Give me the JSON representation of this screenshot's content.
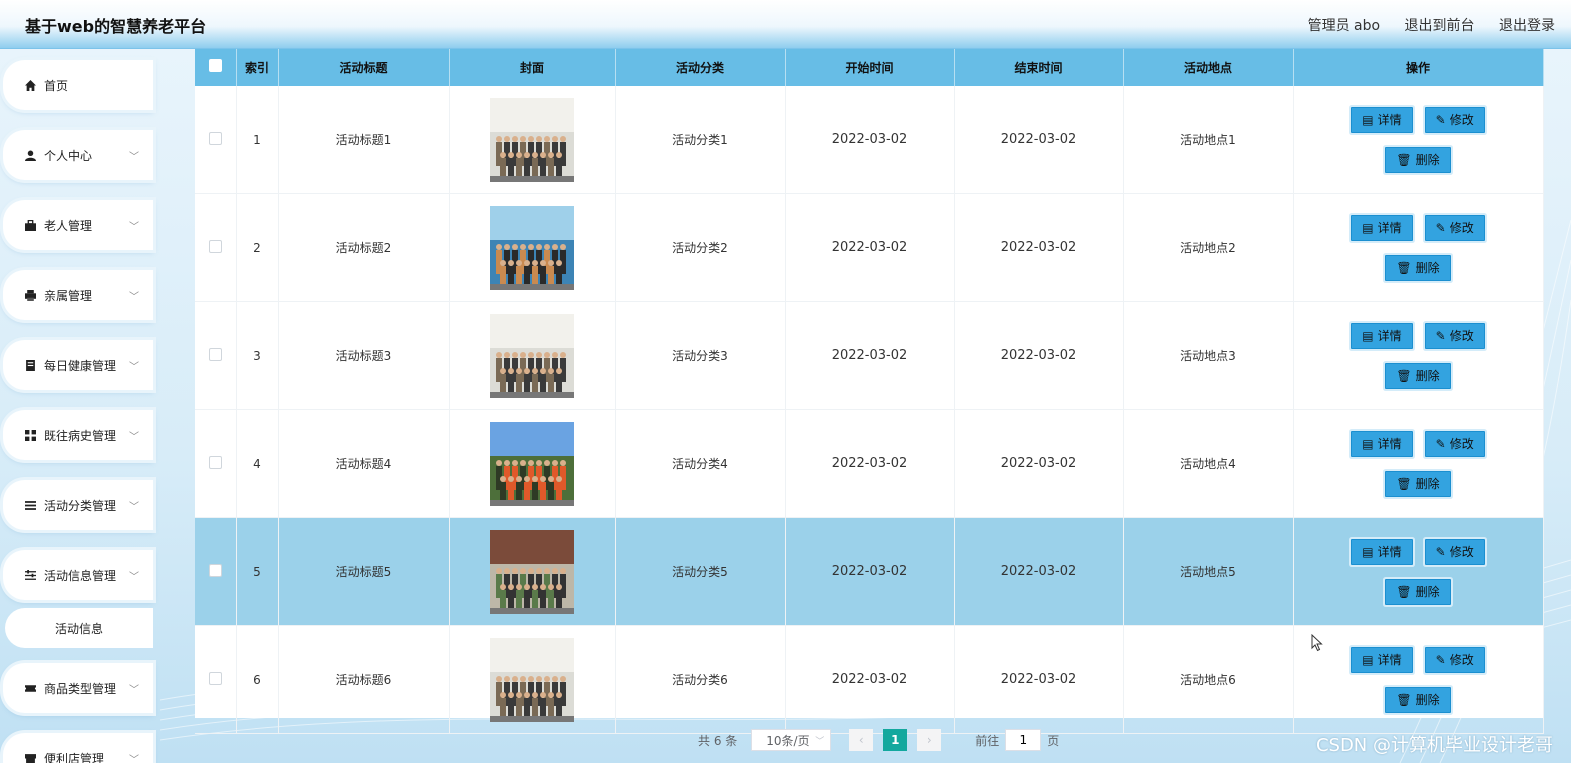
{
  "header": {
    "title": "基于web的智慧养老平台",
    "user": "管理员 abo",
    "to_front": "退出到前台",
    "logout": "退出登录"
  },
  "sidebar": {
    "items": [
      {
        "label": "首页",
        "icon": "home-icon",
        "has_children": false
      },
      {
        "label": "个人中心",
        "icon": "user-icon",
        "has_children": true
      },
      {
        "label": "老人管理",
        "icon": "briefcase-icon",
        "has_children": true
      },
      {
        "label": "亲属管理",
        "icon": "printer-icon",
        "has_children": true
      },
      {
        "label": "每日健康管理",
        "icon": "document-icon",
        "has_children": true
      },
      {
        "label": "既往病史管理",
        "icon": "grid-icon",
        "has_children": true
      },
      {
        "label": "活动分类管理",
        "icon": "list-icon",
        "has_children": true
      },
      {
        "label": "活动信息管理",
        "icon": "sliders-icon",
        "has_children": true
      },
      {
        "label": "商品类型管理",
        "icon": "ticket-icon",
        "has_children": true
      },
      {
        "label": "便利店管理",
        "icon": "store-icon",
        "has_children": true
      }
    ],
    "sub_item": "活动信息"
  },
  "table": {
    "headers": [
      "索引",
      "活动标题",
      "封面",
      "活动分类",
      "开始时间",
      "结束时间",
      "活动地点",
      "操作"
    ],
    "rows": [
      {
        "index": "1",
        "title": "活动标题1",
        "category": "活动分类1",
        "start": "2022-03-02",
        "end": "2022-03-02",
        "place": "活动地点1",
        "cover": "group-photo-indoor"
      },
      {
        "index": "2",
        "title": "活动标题2",
        "category": "活动分类2",
        "start": "2022-03-02",
        "end": "2022-03-02",
        "place": "活动地点2",
        "cover": "group-photo-stage"
      },
      {
        "index": "3",
        "title": "活动标题3",
        "category": "活动分类3",
        "start": "2022-03-02",
        "end": "2022-03-02",
        "place": "活动地点3",
        "cover": "group-photo-indoor"
      },
      {
        "index": "4",
        "title": "活动标题4",
        "category": "活动分类4",
        "start": "2022-03-02",
        "end": "2022-03-02",
        "place": "活动地点4",
        "cover": "group-photo-outdoor"
      },
      {
        "index": "5",
        "title": "活动标题5",
        "category": "活动分类5",
        "start": "2022-03-02",
        "end": "2022-03-02",
        "place": "活动地点5",
        "cover": "group-photo-temple"
      },
      {
        "index": "6",
        "title": "活动标题6",
        "category": "活动分类6",
        "start": "2022-03-02",
        "end": "2022-03-02",
        "place": "活动地点6",
        "cover": "group-photo-indoor"
      }
    ],
    "selected_row": 5,
    "actions": {
      "detail": "详情",
      "edit": "修改",
      "delete": "删除"
    }
  },
  "pagination": {
    "total": "共 6 条",
    "page_size": "10条/页",
    "current_page": "1",
    "goto_prefix": "前往",
    "goto_value": "1",
    "goto_suffix": "页"
  },
  "watermark": "CSDN @计算机毕业设计老哥",
  "colors": {
    "header_accent": "#67bde6",
    "button": "#33a3e0",
    "page_active": "#13a89e",
    "selected_row": "#9bd1ea"
  }
}
